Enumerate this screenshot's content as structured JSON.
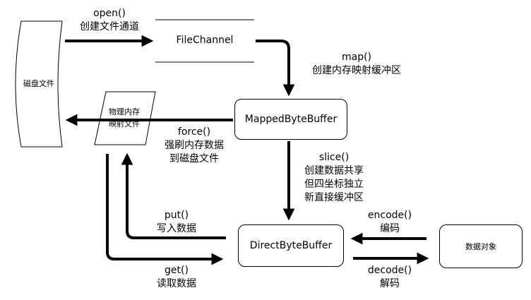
{
  "nodes": {
    "disk_file": "磁盘文件",
    "file_channel": "FileChannel",
    "mapped_byte_buffer": "MappedByteBuffer",
    "physical_memory_map": [
      "物理内存",
      "映射文件"
    ],
    "direct_byte_buffer": "DirectByteBuffer",
    "data_object": "数据对象"
  },
  "edges": {
    "open": [
      "open()",
      "创建文件通道"
    ],
    "map": [
      "map()",
      "创建内存映射缓冲区"
    ],
    "force": [
      "force()",
      "强刷内存数据",
      "到磁盘文件"
    ],
    "slice": [
      "slice()",
      "创建数据共享",
      "但四坐标独立",
      "新直接缓冲区"
    ],
    "put": [
      "put()",
      "写入数据"
    ],
    "get": [
      "get()",
      "读取数据"
    ],
    "encode": [
      "encode()",
      "编码"
    ],
    "decode": [
      "decode()",
      "解码"
    ]
  }
}
